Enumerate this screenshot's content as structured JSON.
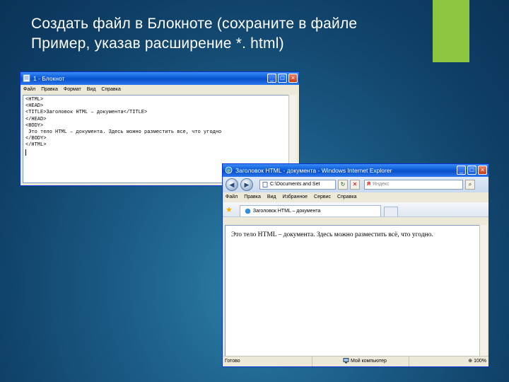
{
  "slide": {
    "title_line1": "Создать файл в Блокноте (сохраните в файле",
    "title_line2": "Пример,  указав расширение  *. html)",
    "accent_color": "#8cc63f"
  },
  "notepad": {
    "title": "1 - Блокнот",
    "icon": "notepad-icon",
    "menu": [
      "Файл",
      "Правка",
      "Формат",
      "Вид",
      "Справка"
    ],
    "lines": [
      "<HTML>",
      "<HEAD>",
      "<TITLE>Заголовок HTML – документа</TITLE>",
      "</HEAD>",
      "<BODY>",
      " Это тело HTML – документа. Здесь можно разместить все, что угодно",
      "</BODY>",
      "</HTML>"
    ]
  },
  "ie": {
    "title": "Заголовок HTML - документа - Windows Internet Explorer",
    "icon": "ie-icon",
    "address": "C:\\Documents and Set",
    "search_placeholder": "Яндекс",
    "menu": [
      "Файл",
      "Правка",
      "Вид",
      "Избранное",
      "Сервис",
      "Справка"
    ],
    "tab_label": "Заголовок HTML – документа",
    "body_text": "Это тело HTML – документа. Здесь можно разместить всё, что угодно.",
    "status": {
      "left": "Готово",
      "zone": "Мой компьютер",
      "zoom": "100%"
    }
  }
}
